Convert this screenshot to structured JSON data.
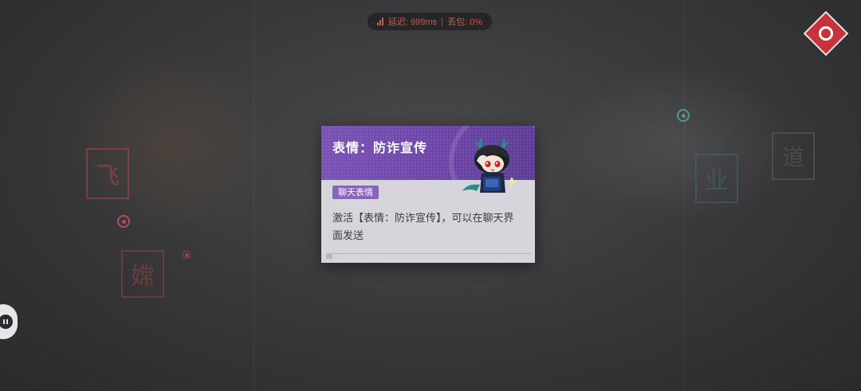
{
  "network": {
    "latency_label": "延迟: 999ms",
    "packet_loss_label": "丢包: 0%"
  },
  "seals": [
    {
      "char": "飞"
    },
    {
      "char": "嫦"
    },
    {
      "char": "业"
    },
    {
      "char": "道"
    }
  ],
  "card": {
    "title": "表情：防诈宣传",
    "tag": "聊天表情",
    "description": "激活【表情：防诈宣传】，可以在聊天界面发送"
  },
  "colors": {
    "card_header": "#7a52b6",
    "tag_bg": "#8a63c0",
    "network_text": "#c35a4e",
    "logo": "#c8323a"
  },
  "icons": {
    "network": "signal-icon",
    "corner": "corner-logo-icon",
    "chat": "chat-icon",
    "sticker": "chibi-character-sticker"
  }
}
